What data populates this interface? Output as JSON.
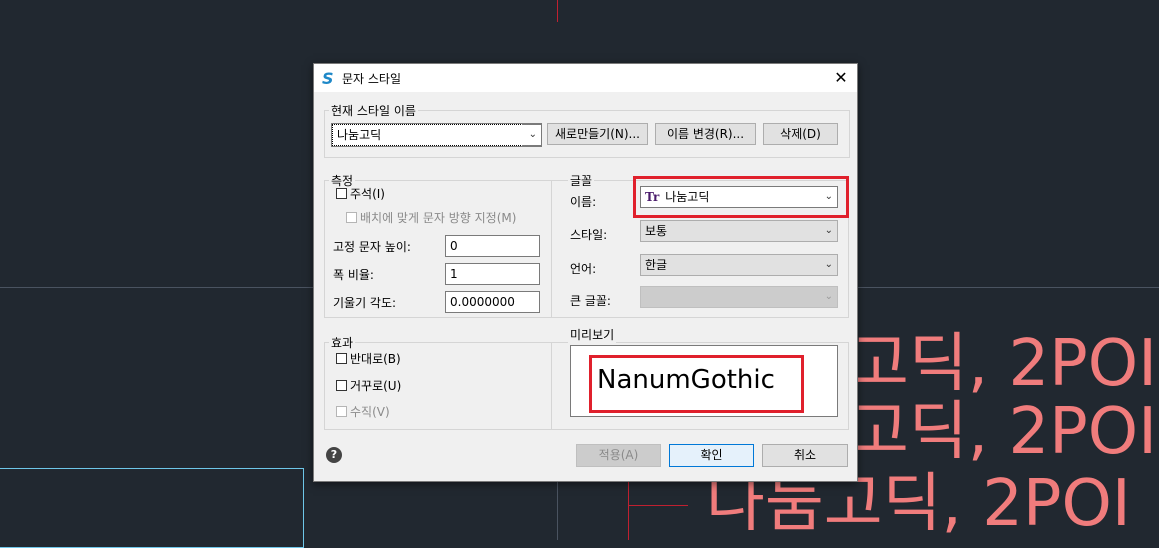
{
  "background_text": [
    "고딕, 2POI",
    "고딕, 2POI",
    "나눔고딕, 2POI"
  ],
  "dialog": {
    "title": "문자 스타일",
    "close_label": "✕",
    "current_style": {
      "group_label": "현재 스타일 이름",
      "selected": "나눔고딕",
      "new_button": "새로만들기(N)...",
      "rename_button": "이름 변경(R)...",
      "delete_button": "삭제(D)"
    },
    "measure": {
      "group_label": "측정",
      "annotative": "주석(I)",
      "match_orientation": "배치에 맞게 문자 방향 지정(M)",
      "height_label": "고정 문자 높이:",
      "height_value": "0",
      "width_label": "폭 비율:",
      "width_value": "1",
      "oblique_label": "기울기 각도:",
      "oblique_value": "0.0000000"
    },
    "font": {
      "group_label": "글꼴",
      "name_label": "이름:",
      "name_value": "나눔고딕",
      "name_icon": "Tr",
      "style_label": "스타일:",
      "style_value": "보통",
      "language_label": "언어:",
      "language_value": "한글",
      "bigfont_label": "큰 글꼴:",
      "bigfont_value": ""
    },
    "effects": {
      "group_label": "효과",
      "backwards": "반대로(B)",
      "upside_down": "거꾸로(U)",
      "vertical": "수직(V)"
    },
    "preview": {
      "group_label": "미리보기",
      "text": "NanumGothic"
    },
    "footer": {
      "help_label": "?",
      "apply_button": "적용(A)",
      "ok_button": "확인",
      "cancel_button": "취소"
    }
  },
  "colors": {
    "highlight": "#e0202c",
    "cad_text": "#f07c7c",
    "background": "#212830"
  }
}
